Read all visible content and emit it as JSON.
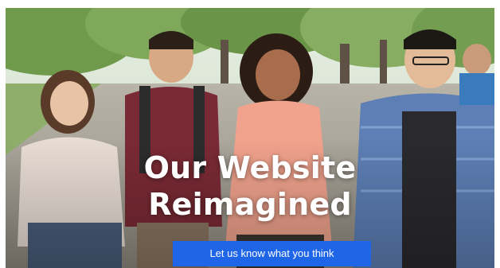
{
  "hero": {
    "photo_subject": "students-walking-campus",
    "headline_line1": "Our Website",
    "headline_line2": "Reimagined",
    "cta_label": "Let us know what you think",
    "cta_color": "#1f65e8"
  }
}
